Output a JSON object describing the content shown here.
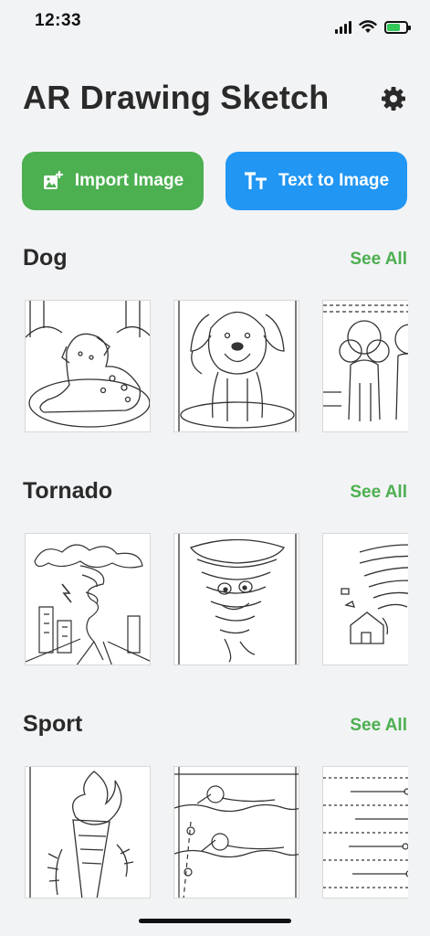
{
  "status": {
    "time": "12:33"
  },
  "header": {
    "title": "AR Drawing Sketch",
    "settings_icon": "gear-icon"
  },
  "actions": {
    "import_label": "Import Image",
    "text_label": "Text to Image",
    "import_color": "#4caf50",
    "text_color": "#2196f3"
  },
  "sections": [
    {
      "title": "Dog",
      "see_all": "See All"
    },
    {
      "title": "Tornado",
      "see_all": "See All"
    },
    {
      "title": "Sport",
      "see_all": "See All"
    }
  ]
}
